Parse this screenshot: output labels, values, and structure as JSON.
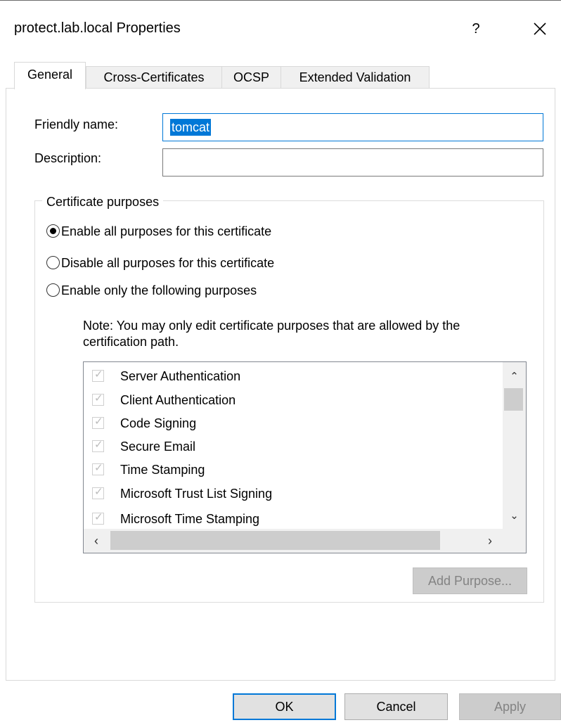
{
  "window": {
    "title": "protect.lab.local Properties",
    "help_label": "?",
    "close_icon": "close-icon"
  },
  "tabs": [
    {
      "label": "General",
      "active": true
    },
    {
      "label": "Cross-Certificates",
      "active": false
    },
    {
      "label": "OCSP",
      "active": false
    },
    {
      "label": "Extended Validation",
      "active": false
    }
  ],
  "general": {
    "friendly_name_label": "Friendly name:",
    "friendly_name_value": "tomcat",
    "description_label": "Description:",
    "description_value": "",
    "group_title": "Certificate purposes",
    "radios": [
      {
        "label": "Enable all purposes for this certificate",
        "selected": true
      },
      {
        "label": "Disable all purposes for this certificate",
        "selected": false
      },
      {
        "label": "Enable only the following purposes",
        "selected": false
      }
    ],
    "note": "Note: You may only edit certificate purposes that are allowed by the certification path.",
    "purposes": [
      {
        "label": "Server Authentication",
        "checked": true
      },
      {
        "label": "Client Authentication",
        "checked": true
      },
      {
        "label": "Code Signing",
        "checked": true
      },
      {
        "label": "Secure Email",
        "checked": true
      },
      {
        "label": "Time Stamping",
        "checked": true
      },
      {
        "label": "Microsoft Trust List Signing",
        "checked": true
      },
      {
        "label": "Microsoft Time Stamping",
        "checked": true
      }
    ],
    "add_purpose_label": "Add Purpose..."
  },
  "buttons": {
    "ok": "OK",
    "cancel": "Cancel",
    "apply": "Apply"
  },
  "colors": {
    "accent": "#0078d7",
    "disabled_button": "#cccccc"
  }
}
